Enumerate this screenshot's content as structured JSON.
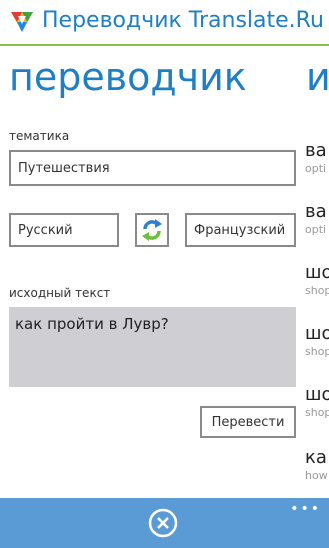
{
  "header": {
    "app_title": "Переводчик Translate.Ru",
    "logo_icon": "triangle-logo-icon"
  },
  "pivot": {
    "current_title": "переводчик",
    "next_title_peek": "и"
  },
  "topic": {
    "label": "тематика",
    "value": "Путешествия"
  },
  "languages": {
    "source": "Русский",
    "target": "Французский",
    "swap_icon": "swap-arrows-icon"
  },
  "source_text": {
    "label": "исходный текст",
    "value": "как пройти в Лувр?"
  },
  "actions": {
    "translate_label": "Перевести"
  },
  "history": [
    {
      "title": "ва",
      "sub": "opti"
    },
    {
      "title": "ва",
      "sub": "opti"
    },
    {
      "title": "шо",
      "sub": "shop"
    },
    {
      "title": "шо",
      "sub": "shop"
    },
    {
      "title": "шо",
      "sub": "shop"
    },
    {
      "title": "ка",
      "sub": "how"
    }
  ],
  "appbar": {
    "close_icon": "close-circle-icon",
    "more_glyph": "•••"
  },
  "colors": {
    "accent": "#1e7fc4",
    "appbar": "#5b9bd5",
    "header_line": "#8bc34a",
    "text_area": "#cfcfd3"
  }
}
